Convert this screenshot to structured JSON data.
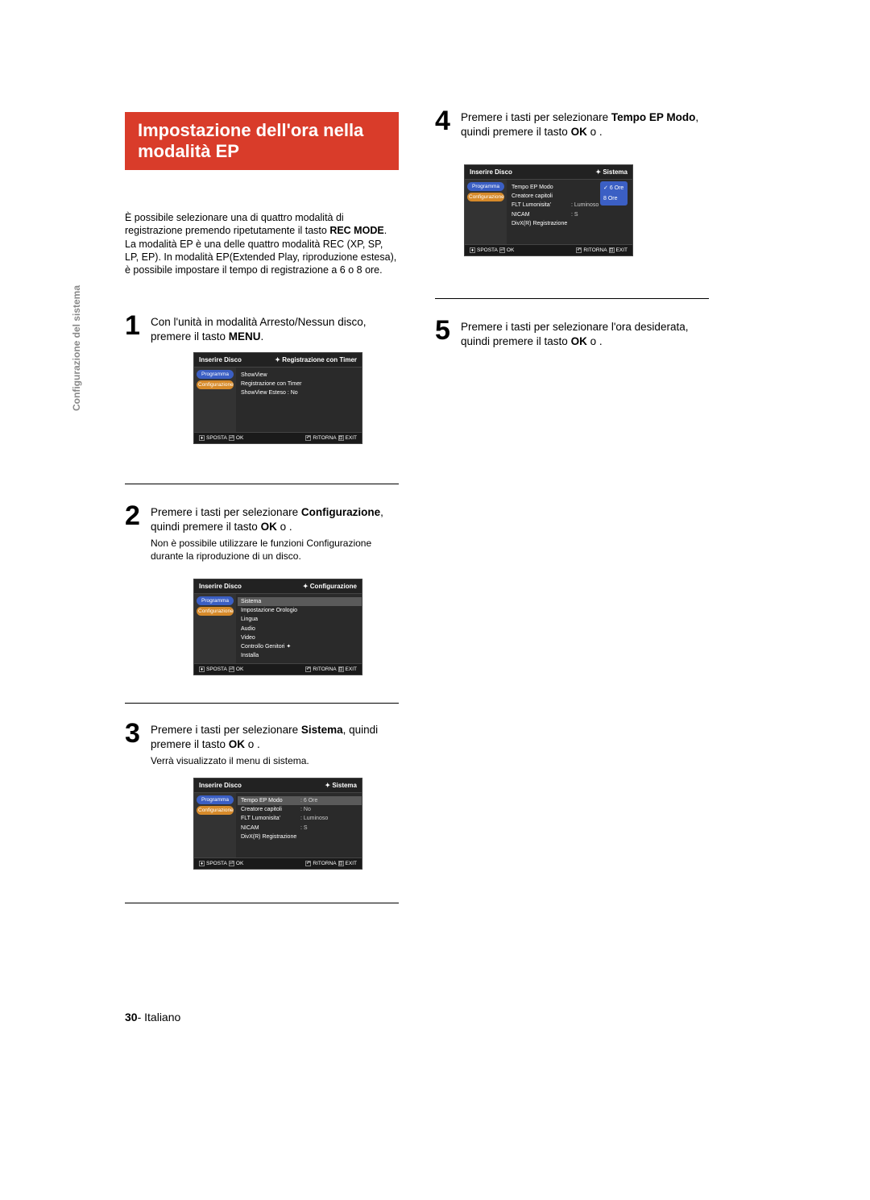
{
  "side_label": "Configurazione del sistema",
  "title": "Impostazione dell'ora nella modalità EP",
  "intro": {
    "t1": "È possibile selezionare una di quattro modalità di registrazione premendo ripetutamente il tasto ",
    "b1": "REC MODE",
    "t2": ". La modalità EP è una delle quattro modalità REC (XP, SP, LP, EP). In modalità EP(Extended Play, riproduzione estesa), è possibile impostare il tempo di registrazione a 6 o 8 ore."
  },
  "steps": {
    "s1": {
      "num": "1",
      "t1": "Con l'unità in modalità Arresto/Nessun disco, premere il tasto ",
      "b1": "MENU",
      "t2": "."
    },
    "s2": {
      "num": "2",
      "t1": "Premere i tasti         per selezionare ",
      "b1": "Configurazione",
      "t2": ", quindi premere il tasto ",
      "b2": "OK",
      "t3": " o       .",
      "note": "Non è possibile utilizzare le funzioni Configurazione durante la riproduzione di un disco."
    },
    "s3": {
      "num": "3",
      "t1": "Premere i tasti         per selezionare ",
      "b1": "Sistema",
      "t2": ", quindi premere il tasto ",
      "b2": "OK",
      "t3": " o       .",
      "note": "Verrà visualizzato il menu di sistema."
    },
    "s4": {
      "num": "4",
      "t1": "Premere i tasti         per selezionare ",
      "b1": "Tempo EP Modo",
      "t2": ", quindi premere il tasto ",
      "b2": "OK",
      "t3": " o       ."
    },
    "s5": {
      "num": "5",
      "t1": "Premere i tasti         per selezionare l'ora desiderata, quindi premere il tasto ",
      "b1": "OK",
      "t2": " o       ."
    }
  },
  "osd": {
    "common_footer": {
      "sposta": "SPOSTA",
      "ok": "OK",
      "ritorna": "RITORNA",
      "exit": "EXIT"
    },
    "tabs": {
      "programma": "Programma",
      "configurazione": "Configurazione"
    },
    "osd1": {
      "hl": "Inserire Disco",
      "hr": "Registrazione con Timer",
      "items": [
        "ShowView",
        "Registrazione con Timer",
        "ShowView Esteso : No"
      ]
    },
    "osd2": {
      "hl": "Inserire Disco",
      "hr": "Configurazione",
      "items": [
        "Sistema",
        "Impostazione Orologio",
        "Lingua",
        "Audio",
        "Video",
        "Controllo Genitori ✦",
        "Installa"
      ]
    },
    "osd3": {
      "hl": "Inserire Disco",
      "hr": "Sistema",
      "rows": [
        {
          "l": "Tempo EP Modo",
          "v": ": 6 Ore",
          "sel": true
        },
        {
          "l": "Creatore capitoli",
          "v": ": No"
        },
        {
          "l": "FLT Lumonisita'",
          "v": ": Luminoso"
        },
        {
          "l": "NICAM",
          "v": ": S"
        },
        {
          "l": "DivX(R) Registrazione",
          "v": ""
        }
      ]
    },
    "osd4": {
      "hl": "Inserire Disco",
      "hr": "Sistema",
      "rows": [
        {
          "l": "Tempo EP Modo",
          "v": ""
        },
        {
          "l": "Creatore capitoli",
          "v": ""
        },
        {
          "l": "FLT Lumonisita'",
          "v": ": Luminoso"
        },
        {
          "l": "NICAM",
          "v": ": S"
        },
        {
          "l": "DivX(R) Registrazione",
          "v": ""
        }
      ],
      "popup": {
        "opt1": "6 Ore",
        "opt2": "8 Ore"
      }
    }
  },
  "footer": {
    "page": "30",
    "dash": "- ",
    "lang": "Italiano"
  }
}
